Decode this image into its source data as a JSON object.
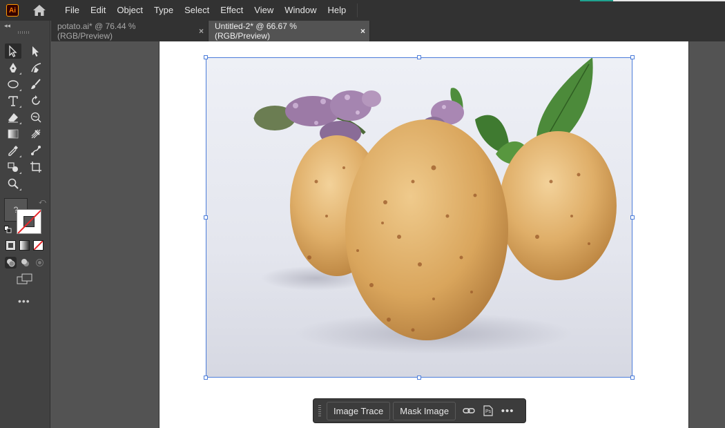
{
  "app": {
    "logo_text": "Ai",
    "brand_color": "#ff9a00",
    "home_icon": "home-icon"
  },
  "menu": [
    "File",
    "Edit",
    "Object",
    "Type",
    "Select",
    "Effect",
    "View",
    "Window",
    "Help"
  ],
  "tabs": [
    {
      "label": "potato.ai* @ 76.44 % (RGB/Preview)",
      "active": false,
      "close": "×"
    },
    {
      "label": "Untitled-2* @ 66.67 % (RGB/Preview)",
      "active": true,
      "close": "×"
    }
  ],
  "tools": {
    "panel_collapse": "◂◂",
    "items": [
      {
        "name": "selection-tool-icon",
        "active": true
      },
      {
        "name": "direct-selection-tool-icon",
        "active": false
      },
      {
        "name": "pen-tool-icon",
        "active": false
      },
      {
        "name": "curvature-tool-icon",
        "active": false
      },
      {
        "name": "ellipse-tool-icon",
        "active": false
      },
      {
        "name": "paintbrush-tool-icon",
        "active": false
      },
      {
        "name": "type-tool-icon",
        "active": false
      },
      {
        "name": "rotate-tool-icon",
        "active": false
      },
      {
        "name": "eraser-tool-icon",
        "active": false
      },
      {
        "name": "warp-tool-icon",
        "active": false
      },
      {
        "name": "gradient-tool-icon",
        "active": false
      },
      {
        "name": "mesh-tool-icon",
        "active": false
      },
      {
        "name": "eyedropper-tool-icon",
        "active": false
      },
      {
        "name": "blend-tool-icon",
        "active": false
      },
      {
        "name": "shape-builder-tool-icon",
        "active": false
      },
      {
        "name": "artboard-tool-icon",
        "active": false
      },
      {
        "name": "zoom-tool-icon",
        "active": false
      }
    ],
    "fill_placeholder": "?",
    "more_label": "•••"
  },
  "image": {
    "subject": "potatoes-with-mint-flowers-photo"
  },
  "selection": {
    "color": "#4a7bd9"
  },
  "taskbar": {
    "image_trace_label": "Image Trace",
    "mask_image_label": "Mask Image",
    "link_icon": "link-icon",
    "ps_icon": "photoshop-edit-icon",
    "ps_text": "Ps",
    "more_icon": "more-options-icon",
    "more_text": "•••"
  }
}
